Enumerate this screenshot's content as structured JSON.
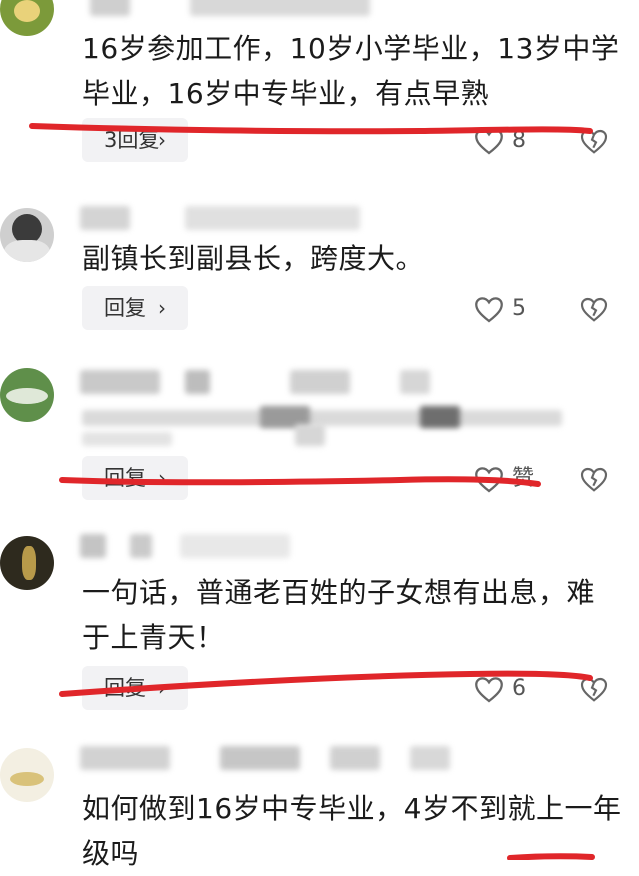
{
  "colors": {
    "background": "#ffffff",
    "text": "#1b1b1b",
    "reply_bg": "#f2f2f4",
    "icon": "#666666",
    "annotation_red": "#e0262a"
  },
  "comments": [
    {
      "text": "16岁参加工作，10岁小学毕业，13岁中学毕业，16岁中专毕业，有点早熟",
      "reply_label": "3回复",
      "reply_chevron": "›",
      "like_count": "8",
      "like_icon": "heart-outline-icon",
      "dislike_icon": "broken-heart-icon"
    },
    {
      "text": "副镇长到副县长，跨度大。",
      "reply_label": "回复",
      "reply_chevron": "›",
      "like_count": "5",
      "like_icon": "heart-outline-icon",
      "dislike_icon": "broken-heart-icon"
    },
    {
      "text": "",
      "reply_label": "回复",
      "reply_chevron": "›",
      "like_count": "赞",
      "like_icon": "heart-outline-icon",
      "dislike_icon": "broken-heart-icon"
    },
    {
      "text": "一句话，普通老百姓的子女想有出息，难于上青天！",
      "reply_label": "回复",
      "reply_chevron": "›",
      "like_count": "6",
      "like_icon": "heart-outline-icon",
      "dislike_icon": "broken-heart-icon"
    },
    {
      "text": "如何做到16岁中专毕业，4岁不到就上一年级吗",
      "reply_label": "",
      "reply_chevron": "",
      "like_count": "",
      "like_icon": "",
      "dislike_icon": ""
    }
  ]
}
